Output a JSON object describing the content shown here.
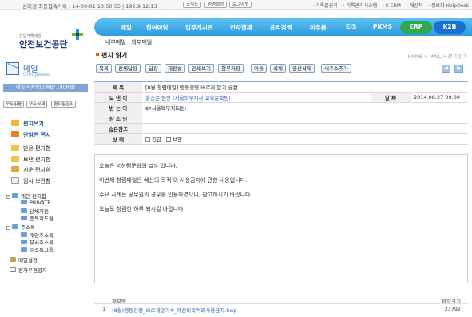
{
  "topstrip": {
    "last_login": "심미경 최종접속기록 : 14-09-01 10:50:55 | 192.9.12.13",
    "buttons": [
      "조직도",
      "환경설정",
      "로그아웃"
    ],
    "links": [
      "· 기록물관리",
      "· 기록관리시스템",
      "· K-CRM",
      "· 메신저",
      "· 정보화 HelpDesk"
    ]
  },
  "logo": {
    "small": "산업재해예방",
    "name": "안전보건공단",
    "sub": "나누리 Groupware"
  },
  "nav": {
    "items": [
      "메일",
      "참여마당",
      "업무게시판",
      "전자결재",
      "윤리경영",
      "아우름",
      "EIS",
      "PKMS"
    ],
    "erp_label": "ERP",
    "k2b_label": "K2B"
  },
  "subnav": {
    "items": [
      "내부메일",
      "외부메일"
    ]
  },
  "sidebar": {
    "title": "메일",
    "subtitle": "Groupware",
    "usage": "메일 사용량(0 MB/ 100MB)",
    "buttons": [
      "모두읽음",
      "모두삭제",
      "편지함관리"
    ],
    "mailboxes": [
      "편지쓰기",
      "안읽은 편지",
      "받은 편지함",
      "보낸 편지함",
      "지운 편지함",
      "임시 보관함"
    ],
    "tree": {
      "personal_label": "개인 편지함",
      "personal_items": [
        "PRIVATE",
        "단체지원",
        "충북지도원"
      ],
      "address_label": "주소록",
      "address_items": [
        "개인주소록",
        "부서주소록",
        "주소록그룹"
      ],
      "settings": "메일설정",
      "notice": "전자우편공지"
    }
  },
  "content": {
    "title": "편지 읽기",
    "breadcrumb": "HOME > MAIL > 편지 읽기",
    "toolbar": [
      "목록",
      "전체답장",
      "답장",
      "재전송",
      "인쇄보기",
      "첨부저장",
      "이동",
      "삭제",
      "완전삭제",
      "새주소추가"
    ],
    "headers": {
      "subject_label": "제    목",
      "subject": "[8월 청렴메일] 행동강령 바르게 알기 @뫈",
      "sender_label": "보 낸 이",
      "sender": "홍승곤 팀장 (서울북부지사,교육문화팀)",
      "date_label": "날    짜",
      "date": "2014.08.27 09:00",
      "to_label": "받 는 이",
      "to": "$*서울북부지도원;",
      "cc_label": "참 조 인",
      "bcc_label": "숨은참조",
      "status_label": "상    태",
      "status_urgent": "긴급",
      "status_secure": "보안"
    },
    "body": [
      "오늘은 <청렴문화의 날> 입니다.",
      "이번제 청렴메일은 예산의 목적 외 사용금지에 관한 내용입니다.",
      "주요 사례는 공무원의 경우를 인용하였으니, 참고하시기 바랍니다.",
      "오늘도 청렴한 하루 되시길 바랍니다."
    ],
    "attachment": {
      "name_label": "첨부명",
      "size_label": "파일크기",
      "index": "1",
      "file": "(8월)행동강령_바르게알기④_예산의목적외사용금지.hwp",
      "size": "33792"
    }
  }
}
